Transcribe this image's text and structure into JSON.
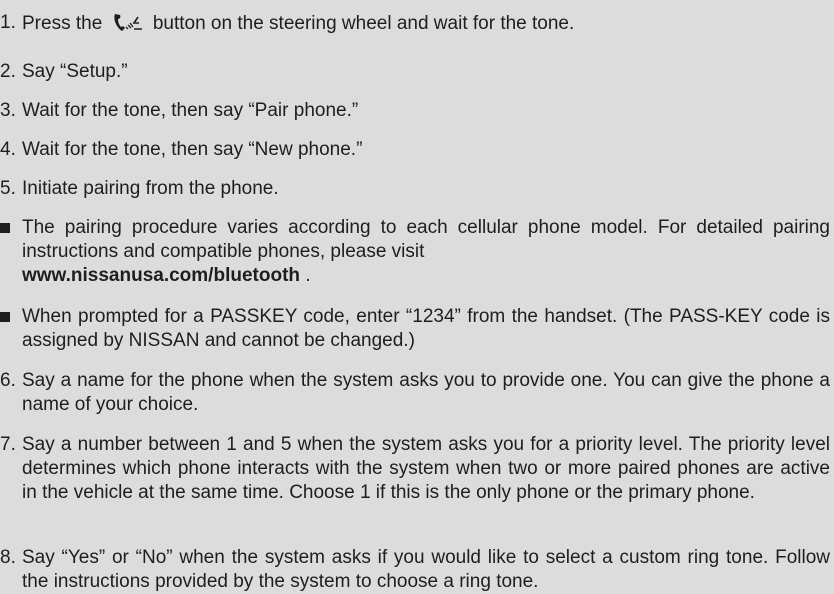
{
  "steps": {
    "s1_before": "Press the",
    "s1_after": "button on the steering wheel and wait for the tone.",
    "s2": "Say “Setup.”",
    "s3": "Wait for the tone, then say “Pair phone.”",
    "s4": "Wait for the tone, then say “New phone.”",
    "s5": "Initiate pairing from the phone.",
    "s6": "Say a name for the phone when the system asks you to provide one. You can give the phone a name of your choice.",
    "s7": "Say a number between 1 and 5 when the system asks you for a priority level. The priority level determines which phone interacts with the system when two or more paired phones are active in the vehicle at the same time. Choose 1 if this is the only phone or the primary phone.",
    "s8": "Say “Yes” or “No” when the system asks if you would like to select a custom ring tone. Follow the instructions provided by the system to choose a ring tone."
  },
  "numbers": [
    "1.",
    "2.",
    "3.",
    "4.",
    "5.",
    "6.",
    "7.",
    "8."
  ],
  "notes": {
    "n1_text": "The pairing procedure varies according to each cellular phone model. For detailed pairing instructions and compatible phones, please visit",
    "n1_link": "www.nissanusa.com/bluetooth",
    "n1_end": " .",
    "n2": "When prompted for a PASSKEY code, enter “1234” from the handset. (The PASS-KEY code is assigned by NISSAN and cannot be changed.)"
  },
  "icons": {
    "phone_voice_button": "phone-voice-icon"
  }
}
